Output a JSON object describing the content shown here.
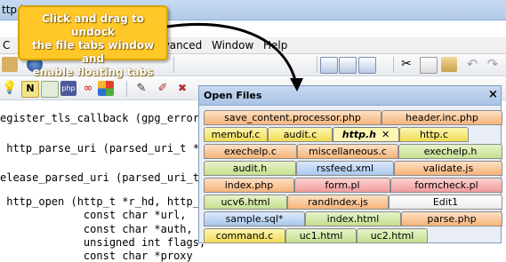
{
  "window": {
    "title": "ttp.h"
  },
  "menu": {
    "items": [
      "C",
      "dvanced",
      "Window",
      "Help"
    ]
  },
  "toolbar": {
    "search_text": "([^\\]+)/"
  },
  "code": {
    "lines": [
      "egister_tls_callback (gpg_error_t",
      "",
      " http_parse_uri (parsed_uri_t *re",
      "",
      "elease_parsed_uri (parsed_uri_t u",
      "",
      " http_open (http_t *r_hd, http_re",
      "             const char *url,",
      "             const char *auth,",
      "             unsigned int flags,",
      "             const char *proxy"
    ]
  },
  "open_files": {
    "title": "Open Files",
    "rows": [
      [
        {
          "label": "save_content.processor.php",
          "color": "orange"
        },
        {
          "label": "header.inc.php",
          "color": "orange"
        }
      ],
      [
        {
          "label": "membuf.c",
          "color": "yellow"
        },
        {
          "label": "audit.c",
          "color": "yellow"
        },
        {
          "label": "http.h",
          "color": "active"
        },
        {
          "label": "http.c",
          "color": "yellow"
        }
      ],
      [
        {
          "label": "exechelp.c",
          "color": "orange"
        },
        {
          "label": "miscellaneous.c",
          "color": "orange"
        },
        {
          "label": "exechelp.h",
          "color": "green"
        }
      ],
      [
        {
          "label": "audit.h",
          "color": "green"
        },
        {
          "label": "rssfeed.xml",
          "color": "blue"
        },
        {
          "label": "validate.js",
          "color": "orange"
        }
      ],
      [
        {
          "label": "index.php",
          "color": "orange"
        },
        {
          "label": "form.pl",
          "color": "pink"
        },
        {
          "label": "formcheck.pl",
          "color": "pink"
        }
      ],
      [
        {
          "label": "ucv6.html",
          "color": "green"
        },
        {
          "label": "randIndex.js",
          "color": "orange"
        },
        {
          "label": "Edit1",
          "color": "white"
        }
      ],
      [
        {
          "label": "sample.sql*",
          "color": "blue"
        },
        {
          "label": "index.html",
          "color": "green"
        },
        {
          "label": "parse.php",
          "color": "orange"
        }
      ],
      [
        {
          "label": "command.c",
          "color": "yellow"
        },
        {
          "label": "uc1.html",
          "color": "green"
        },
        {
          "label": "uc2.html",
          "color": "green"
        }
      ]
    ],
    "active_close_glyph": "✕"
  },
  "callout": {
    "text_lines": [
      "Click and drag to undock",
      "the file tabs window and",
      "enable floating tabs"
    ]
  },
  "colors": {
    "callout_fill": "#ffc727",
    "tab_orange": "#f6b37a",
    "tab_yellow": "#f0dc55",
    "tab_green": "#c5e08f",
    "tab_blue": "#a9c7ee",
    "tab_pink": "#f19b9b"
  },
  "icons": [
    "folder-icon",
    "save-icon",
    "cut-icon",
    "copy-icon",
    "paste-icon",
    "undo-icon",
    "redo-icon",
    "bulb-icon",
    "n-icon",
    "php-icon",
    "clipboard-icon",
    "close-icon"
  ]
}
